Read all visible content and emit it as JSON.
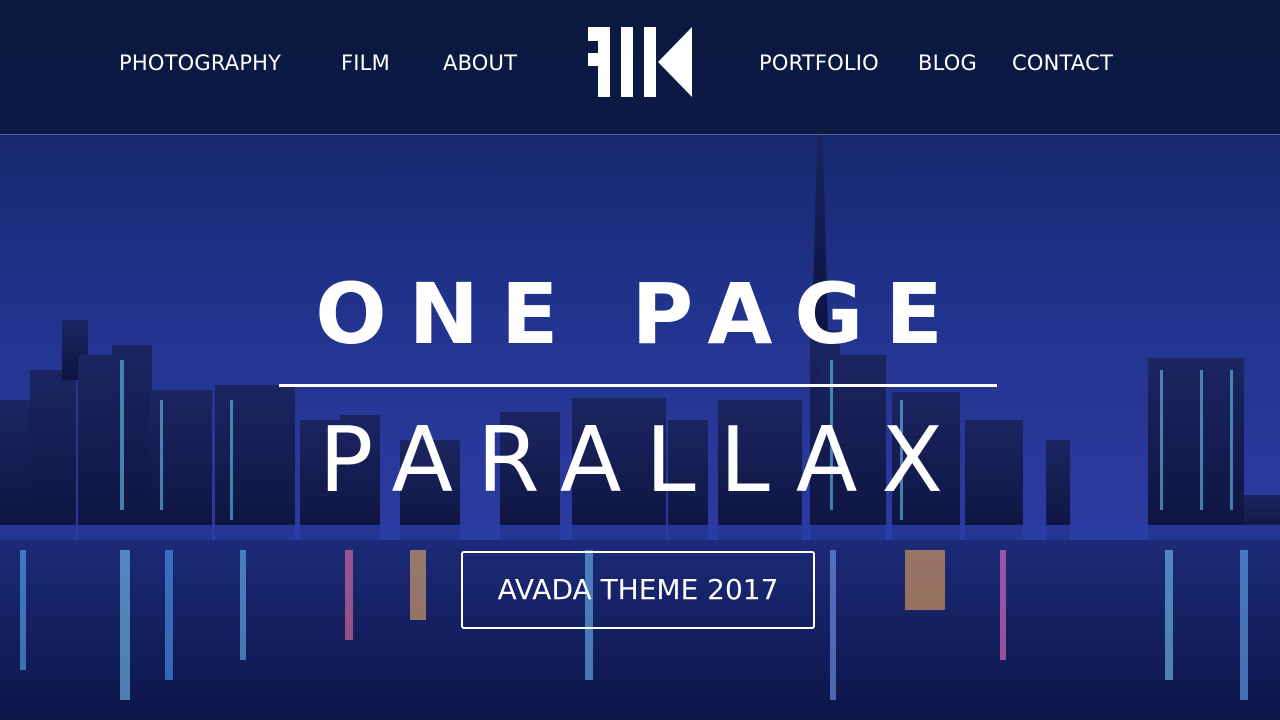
{
  "nav": {
    "left_items": [
      {
        "label": "PHOTOGRAPHY"
      },
      {
        "label": "FILM"
      },
      {
        "label": "ABOUT"
      }
    ],
    "right_items": [
      {
        "label": "PORTFOLIO"
      },
      {
        "label": "BLOG"
      },
      {
        "label": "CONTACT"
      }
    ]
  },
  "logo": {
    "icon": "fk-monogram-logo-icon"
  },
  "hero": {
    "title_line1": "ONE PAGE",
    "title_line2": "PARALLAX",
    "cta_label": "AVADA THEME 2017",
    "background": "city-skyline-night-photo"
  },
  "colors": {
    "nav_background": "#0a1838",
    "sky": "#1d2f7a",
    "text": "#ffffff"
  }
}
